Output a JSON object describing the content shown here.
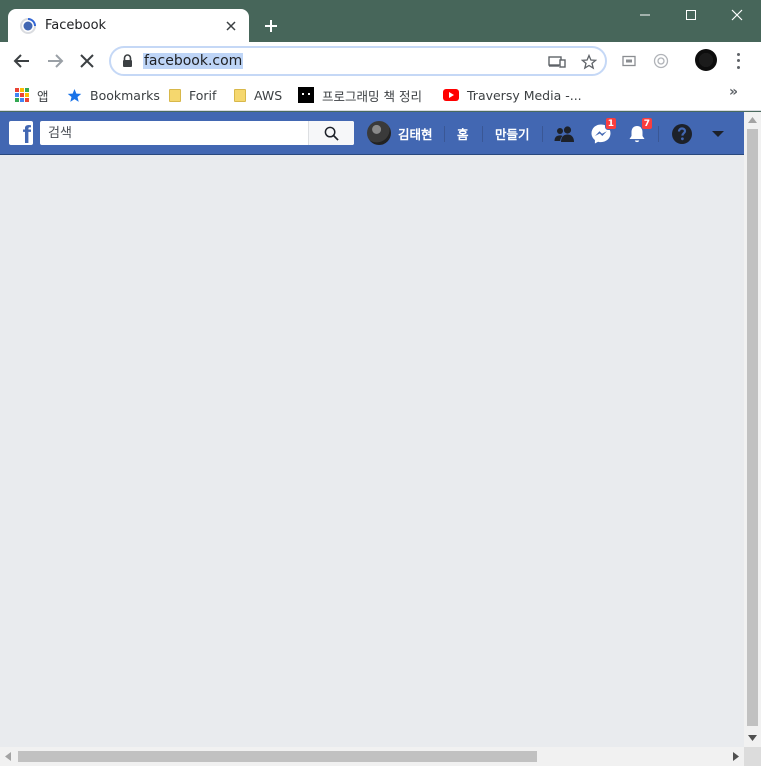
{
  "window": {
    "controls": [
      "minimize",
      "maximize",
      "close"
    ]
  },
  "tab": {
    "title": "Facebook",
    "icon": "loading-favicon-icon"
  },
  "toolbar": {
    "url": "facebook.com",
    "back_icon": "back-arrow-icon",
    "forward_icon": "forward-arrow-icon",
    "stop_icon": "stop-loading-icon"
  },
  "bookmarks": {
    "items": [
      {
        "label": "앱",
        "icon": "apps-grid-icon"
      },
      {
        "label": "Bookmarks",
        "icon": "star-icon"
      },
      {
        "label": "Forif",
        "icon": "folder-icon"
      },
      {
        "label": "AWS",
        "icon": "folder-icon"
      },
      {
        "label": "프로그래밍 책 정리",
        "icon": "black-square-icon"
      },
      {
        "label": "Traversy Media -...",
        "icon": "youtube-icon"
      }
    ],
    "overflow": "»"
  },
  "facebook": {
    "search_placeholder": "검색",
    "user_name": "김태현",
    "nav_home": "홈",
    "nav_create": "만들기",
    "messenger_badge": "1",
    "notifications_badge": "7",
    "colors": {
      "header": "#4267b2",
      "body": "#e9ebee",
      "badge": "#fa3e3e"
    }
  }
}
